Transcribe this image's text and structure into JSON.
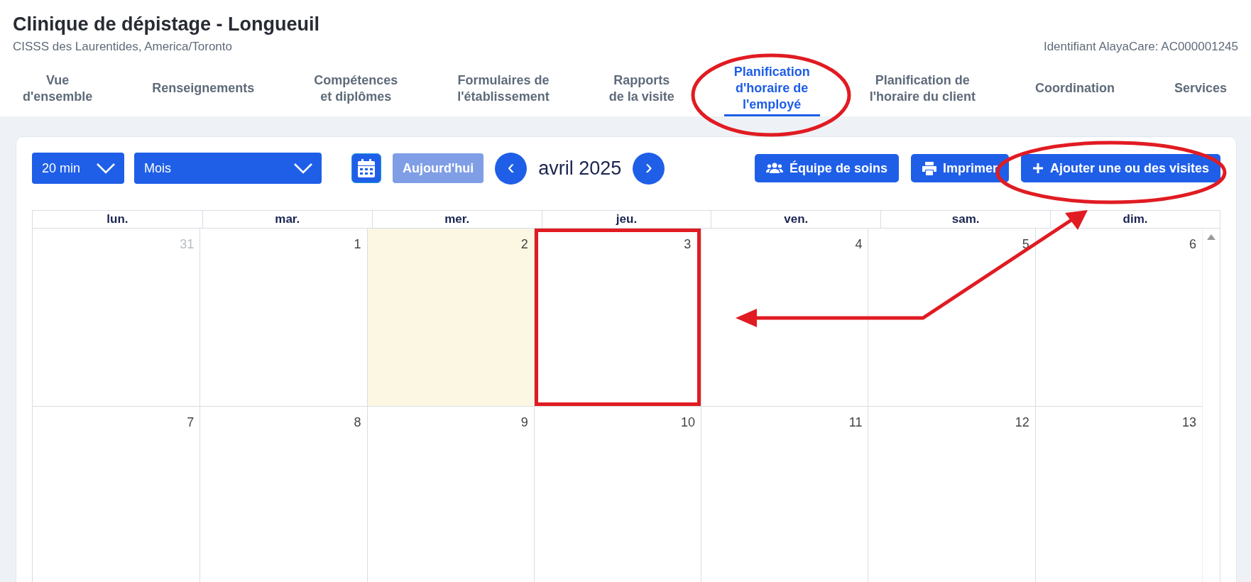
{
  "header": {
    "title": "Clinique de dépistage - Longueuil",
    "subtitle": "CISSS des Laurentides, America/Toronto",
    "identifier": "Identifiant AlayaCare: AC000001245"
  },
  "tabs": [
    {
      "label": "Vue\nd'ensemble",
      "selected": false
    },
    {
      "label": "Renseignements",
      "selected": false
    },
    {
      "label": "Compétences\net diplômes",
      "selected": false
    },
    {
      "label": "Formulaires de\nl'établissement",
      "selected": false
    },
    {
      "label": "Rapports\nde la visite",
      "selected": false
    },
    {
      "label": "Planification\nd'horaire de\nl'employé",
      "selected": true
    },
    {
      "label": "Planification de\nl'horaire du client",
      "selected": false
    },
    {
      "label": "Coordination",
      "selected": false
    },
    {
      "label": "Services",
      "selected": false
    }
  ],
  "toolbar": {
    "interval": "20 min",
    "view": "Mois",
    "today": "Aujourd'hui",
    "today_disabled": true,
    "prev": "‹",
    "month": "avril 2025",
    "next": "›",
    "buttons": [
      {
        "kind": "team",
        "label": "Équipe de soins"
      },
      {
        "kind": "print",
        "label": "Imprimer"
      },
      {
        "kind": "add",
        "label": "Ajouter une ou des visites"
      }
    ]
  },
  "calendar": {
    "weekdays": [
      "lun.",
      "mar.",
      "mer.",
      "jeu.",
      "ven.",
      "sam.",
      "dim."
    ],
    "weeks": [
      [
        {
          "day": "31",
          "other_month": true,
          "today": false
        },
        {
          "day": "1",
          "other_month": false,
          "today": false
        },
        {
          "day": "2",
          "other_month": false,
          "today": true
        },
        {
          "day": "3",
          "other_month": false,
          "today": false,
          "highlighted": true
        },
        {
          "day": "4",
          "other_month": false,
          "today": false
        },
        {
          "day": "5",
          "other_month": false,
          "today": false
        },
        {
          "day": "6",
          "other_month": false,
          "today": false
        }
      ],
      [
        {
          "day": "7",
          "other_month": false,
          "today": false
        },
        {
          "day": "8",
          "other_month": false,
          "today": false
        },
        {
          "day": "9",
          "other_month": false,
          "today": false
        },
        {
          "day": "10",
          "other_month": false,
          "today": false
        },
        {
          "day": "11",
          "other_month": false,
          "today": false
        },
        {
          "day": "12",
          "other_month": false,
          "today": false
        },
        {
          "day": "13",
          "other_month": false,
          "today": false
        }
      ]
    ]
  },
  "annotations": [
    {
      "kind": "ellipse"
    },
    {
      "kind": "ellipse"
    },
    {
      "kind": "arrow"
    }
  ]
}
